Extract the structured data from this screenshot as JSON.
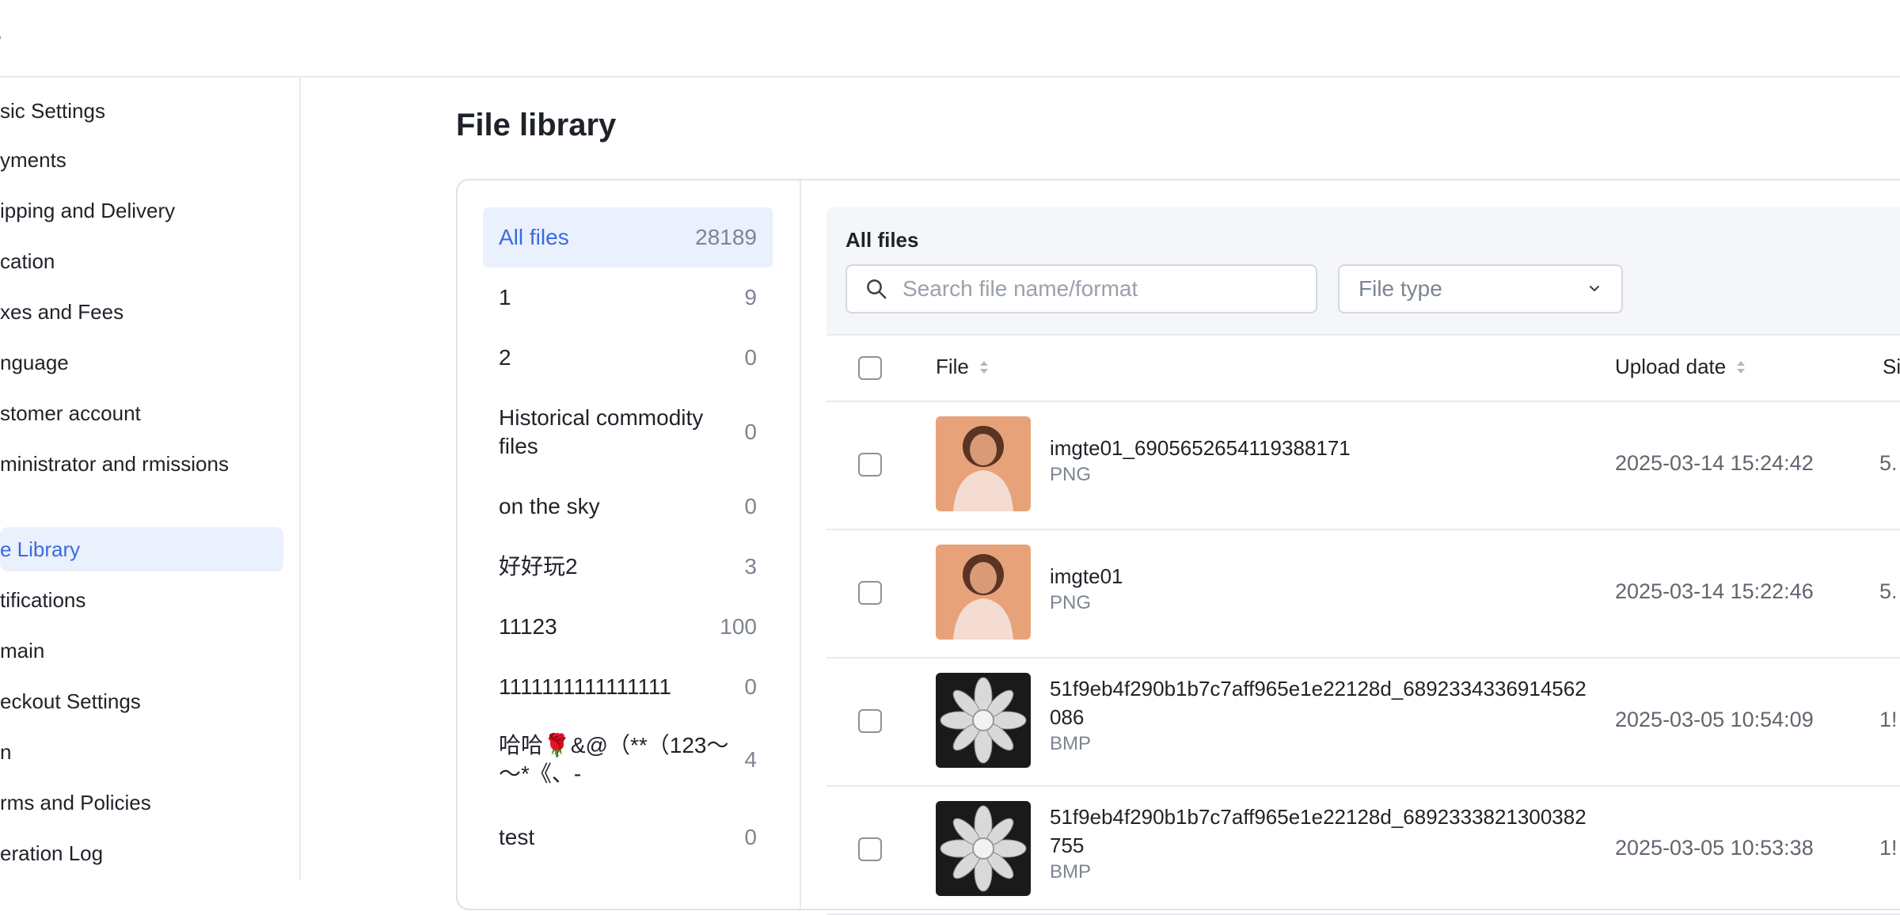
{
  "header": {
    "title": "gs"
  },
  "sidebar": {
    "items": [
      {
        "label": "sic Settings"
      },
      {
        "label": "yments"
      },
      {
        "label": "ipping and Delivery"
      },
      {
        "label": "cation"
      },
      {
        "label": "xes and Fees"
      },
      {
        "label": "nguage"
      },
      {
        "label": "stomer account"
      },
      {
        "label": "ministrator and rmissions"
      },
      {
        "label": "e Library"
      },
      {
        "label": "tifications"
      },
      {
        "label": "main"
      },
      {
        "label": "eckout Settings"
      },
      {
        "label": "n"
      },
      {
        "label": "rms and Policies"
      },
      {
        "label": "eration Log"
      }
    ]
  },
  "main": {
    "title": "File library"
  },
  "folders": [
    {
      "name": "All files",
      "count": "28189"
    },
    {
      "name": "1",
      "count": "9"
    },
    {
      "name": "2",
      "count": "0"
    },
    {
      "name": "Historical commodity files",
      "count": "0"
    },
    {
      "name": "on the sky",
      "count": "0"
    },
    {
      "name": "好好玩2",
      "count": "3"
    },
    {
      "name": "11123",
      "count": "100"
    },
    {
      "name": "1111111111111111",
      "count": "0"
    },
    {
      "name": "哈哈🌹&@（**（123～～*《、-",
      "count": "4"
    },
    {
      "name": "test",
      "count": "0"
    }
  ],
  "files": {
    "title": "All files",
    "search_placeholder": "Search file name/format",
    "filetype_placeholder": "File type",
    "columns": {
      "file": "File",
      "upload_date": "Upload date",
      "size": "Si"
    },
    "rows": [
      {
        "name": "imgte01_6905652654119388171",
        "format": "PNG",
        "date": "2025-03-14 15:24:42",
        "size": "5.",
        "thumb": "person"
      },
      {
        "name": "imgte01",
        "format": "PNG",
        "date": "2025-03-14 15:22:46",
        "size": "5.",
        "thumb": "person"
      },
      {
        "name": "51f9eb4f290b1b7c7aff965e1e22128d_6892334336914562086",
        "format": "BMP",
        "date": "2025-03-05 10:54:09",
        "size": "1!",
        "thumb": "flower"
      },
      {
        "name": "51f9eb4f290b1b7c7aff965e1e22128d_6892333821300382755",
        "format": "BMP",
        "date": "2025-03-05 10:53:38",
        "size": "1!",
        "thumb": "flower"
      }
    ]
  },
  "colors": {
    "accent": "#3a6be0",
    "active_bg": "#ebf0fd"
  },
  "icons": {
    "search": "search-icon",
    "dropdown": "chevron-down-icon",
    "sort": "sort-icon"
  }
}
